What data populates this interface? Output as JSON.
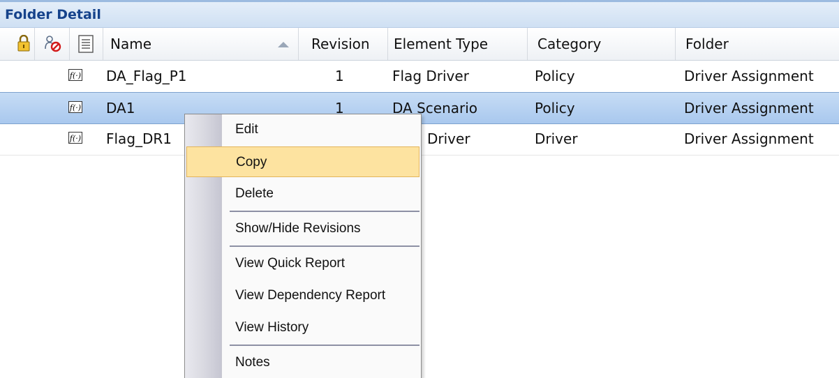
{
  "panel": {
    "title": "Folder Detail"
  },
  "columns": {
    "lock": "lock-icon",
    "status": "user-blocked-icon",
    "notes": "document-icon",
    "name": "Name",
    "revision": "Revision",
    "element_type": "Element Type",
    "category": "Category",
    "folder": "Folder"
  },
  "rows": [
    {
      "icon": "function-icon",
      "name": "DA_Flag_P1",
      "revision": "1",
      "element_type": "Flag Driver",
      "category": "Policy",
      "folder": "Driver Assignment",
      "selected": false
    },
    {
      "icon": "function-icon",
      "name": "DA1",
      "revision": "1",
      "element_type": "DA Scenario",
      "category": "Policy",
      "folder": "Driver Assignment",
      "selected": true
    },
    {
      "icon": "function-icon",
      "name": "Flag_DR1",
      "revision": "",
      "element_type": "Flag Driver",
      "element_type_visible": "Driver",
      "category": "Driver",
      "folder": "Driver Assignment",
      "selected": false
    }
  ],
  "context_menu": {
    "items": [
      {
        "label": "Edit"
      },
      {
        "label": "Copy",
        "highlighted": true
      },
      {
        "label": "Delete"
      },
      {
        "label": "Show/Hide Revisions"
      },
      {
        "label": "View Quick Report"
      },
      {
        "label": "View Dependency Report"
      },
      {
        "label": "View History"
      },
      {
        "label": "Notes"
      }
    ]
  },
  "colors": {
    "panel_title": "#15428b",
    "selected_row": "#b4d0f1",
    "menu_highlight": "#fde3a0"
  }
}
